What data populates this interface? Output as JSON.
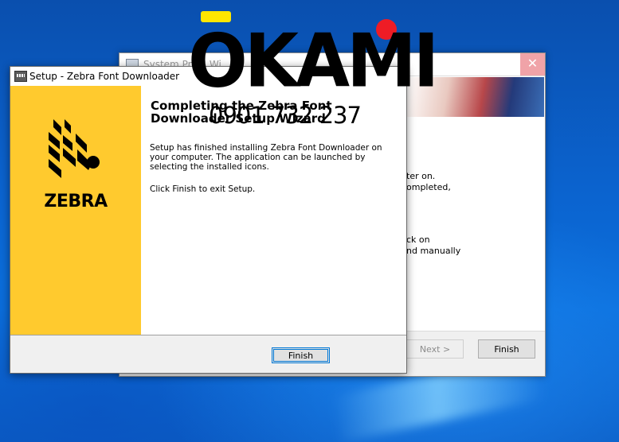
{
  "back_window": {
    "title": "System Pre... Wi",
    "close_glyph": "✕",
    "text_lines": [
      "ter on.",
      "ompleted,",
      "ck on",
      "nd manually"
    ],
    "next_label": "Next >",
    "finish_label": "Finish"
  },
  "dialog": {
    "title": "Setup - Zebra Font Downloader",
    "brand": "ZEBRA",
    "heading_line1": "Completing the Zebra Font",
    "heading_line2": "Downloader Setup Wizard",
    "paragraph1": "Setup has finished installing Zebra Font Downloader on your computer. The application can be launched by selecting the installed icons.",
    "paragraph2": "Click Finish to exit Setup.",
    "finish_label": "Finish"
  },
  "watermark": {
    "logo_text": "OKAMI",
    "phone": "0901 732 237"
  },
  "colors": {
    "zebra_yellow": "#ffca2e",
    "focus_blue": "#0078d7",
    "watermark_yellow": "#ffe600",
    "watermark_red": "#ee1c25"
  },
  "icons": [
    "setup-app-icon",
    "zebra-head-icon",
    "close-icon"
  ]
}
